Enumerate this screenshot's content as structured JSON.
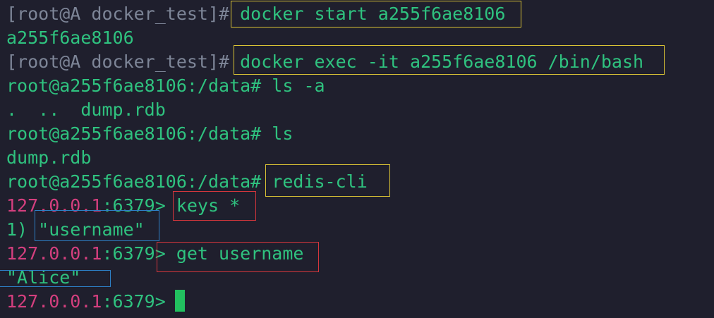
{
  "terminal": {
    "lines": [
      {
        "prompt": "[root@A docker_test]#",
        "command": " docker start a255f6ae8106"
      },
      {
        "output": "a255f6ae8106"
      },
      {
        "prompt": "[root@A docker_test]#",
        "command": " docker exec -it a255f6ae8106 /bin/bash"
      },
      {
        "prompt": "root@a255f6ae8106:/data#",
        "command": " ls -a"
      },
      {
        "output": ".  ..  dump.rdb"
      },
      {
        "prompt": "root@a255f6ae8106:/data#",
        "command": " ls"
      },
      {
        "output": "dump.rdb"
      },
      {
        "prompt": "root@a255f6ae8106:/data#",
        "command": " redis-cli"
      },
      {
        "redis_ip": "127.0.0.1",
        "redis_port": ":6379>",
        "command": " keys *"
      },
      {
        "output": "1) \"username\""
      },
      {
        "redis_ip": "127.0.0.1",
        "redis_port": ":6379>",
        "command": " get username"
      },
      {
        "output": "\"Alice\""
      },
      {
        "redis_ip": "127.0.0.1",
        "redis_port": ":6379>",
        "command": ""
      }
    ]
  },
  "colors": {
    "background": "#1f1f2d",
    "text_green": "#2fc27f",
    "prompt_gray": "#7d8597",
    "redis_ip_magenta": "#d43f7e",
    "highlight_yellow": "#d9c235",
    "highlight_red": "#d6363c",
    "highlight_blue": "#2d7fc5",
    "cursor_green": "#22c05f"
  }
}
